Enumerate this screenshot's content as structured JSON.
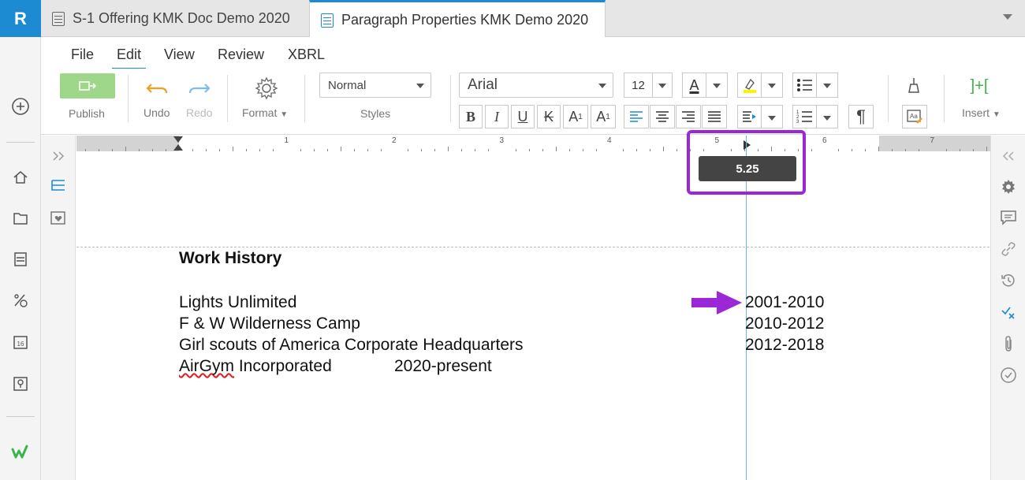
{
  "app": {
    "logo_letter": "R"
  },
  "tabs": [
    {
      "label": "S-1 Offering KMK Doc Demo 2020",
      "active": false
    },
    {
      "label": "Paragraph Properties KMK Demo 2020",
      "active": true
    }
  ],
  "menu": [
    "File",
    "Edit",
    "View",
    "Review",
    "XBRL"
  ],
  "menu_active": "Edit",
  "ribbon": {
    "publish_label": "Publish",
    "undo_label": "Undo",
    "redo_label": "Redo",
    "format_label": "Format",
    "styles_value": "Normal",
    "styles_label": "Styles",
    "font_value": "Arial",
    "size_value": "12",
    "insert_label": "Insert",
    "bold": "B",
    "italic": "I",
    "underline": "U",
    "strike": "K",
    "superscript": "A",
    "subscript": "A",
    "pilcrow": "¶",
    "insert_glyph": "]+["
  },
  "ruler": {
    "numbers": [
      "1",
      "2",
      "3",
      "4",
      "5",
      "6",
      "7"
    ],
    "tooltip_value": "5.25"
  },
  "document": {
    "heading": "Work History",
    "rows": [
      {
        "name": "Lights Unlimited",
        "years": "2001-2010"
      },
      {
        "name": "F & W Wilderness Camp",
        "years": "2010-2012"
      },
      {
        "name": "Girl scouts of America Corporate Headquarters",
        "years": "2012-2018"
      }
    ],
    "last_row": {
      "name": "AirGym",
      "rest": " Incorporated",
      "years": "2020-present"
    }
  },
  "colors": {
    "accent": "#1d8bd1",
    "annotation": "#9b27d8",
    "publish": "#9ed68a",
    "guide": "#6ab7e8"
  },
  "icons": {
    "left_sidebar": [
      "plus-circle-icon",
      "home-icon",
      "folder-icon",
      "form-icon",
      "percent-icon",
      "calendar-icon",
      "location-icon",
      "workiva-logo"
    ],
    "right_sidebar": [
      "collapse-left-icon",
      "gear-icon",
      "comment-icon",
      "link-icon",
      "history-icon",
      "tasks-icon",
      "attachment-icon",
      "check-circle-icon"
    ]
  }
}
